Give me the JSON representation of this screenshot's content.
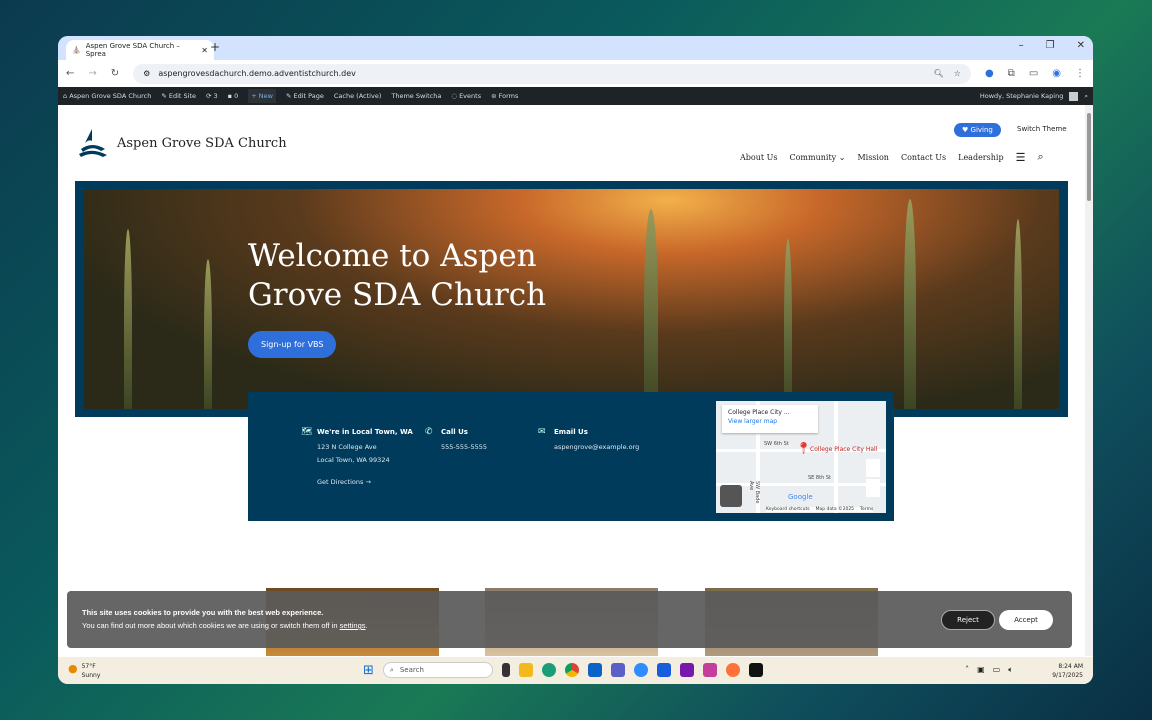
{
  "browser": {
    "tab_title": "Aspen Grove SDA Church – Sprea",
    "url": "aspengrovesdachurch.demo.adventistchurch.dev"
  },
  "wpbar": {
    "site": "Aspen Grove SDA Church",
    "edit_site": "Edit Site",
    "updates": "3",
    "comments": "0",
    "new": "New",
    "edit_page": "Edit Page",
    "cache": "Cache (Active)",
    "theme": "Theme Switcha",
    "events": "Events",
    "forms": "Forms",
    "howdy": "Howdy, Stephanie Kaping"
  },
  "header": {
    "site_name": "Aspen Grove SDA Church",
    "giving": "Giving",
    "switch_theme": "Switch Theme",
    "nav": [
      "About Us",
      "Community",
      "Mission",
      "Contact Us",
      "Leadership"
    ]
  },
  "hero": {
    "title": "Welcome to Aspen Grove SDA Church",
    "cta": "Sign-up for VBS"
  },
  "info": {
    "location_title": "We're in Local Town, WA",
    "address1": "123 N College Ave",
    "address2": "Local Town, WA 99324",
    "directions": "Get Directions",
    "call_title": "Call Us",
    "phone": "555-555-5555",
    "email_title": "Email Us",
    "email": "aspengrove@example.org"
  },
  "map": {
    "place": "College Place City ...",
    "view_larger": "View larger map",
    "pin_label": "College Place City Hall",
    "streets": [
      "SW 6th St",
      "SE 8th St",
      "SW Bade Ave"
    ],
    "footer": [
      "Keyboard shortcuts",
      "Map data ©2025",
      "Terms"
    ],
    "brand": "Google"
  },
  "cookie": {
    "title": "This site uses cookies to provide you with the best web experience.",
    "text": "You can find out more about which cookies we are using or switch them off in ",
    "link": "settings",
    "reject": "Reject",
    "accept": "Accept"
  },
  "taskbar": {
    "temp": "57°F",
    "weather": "Sunny",
    "search": "Search",
    "time": "8:24 AM",
    "date": "9/17/2025"
  }
}
